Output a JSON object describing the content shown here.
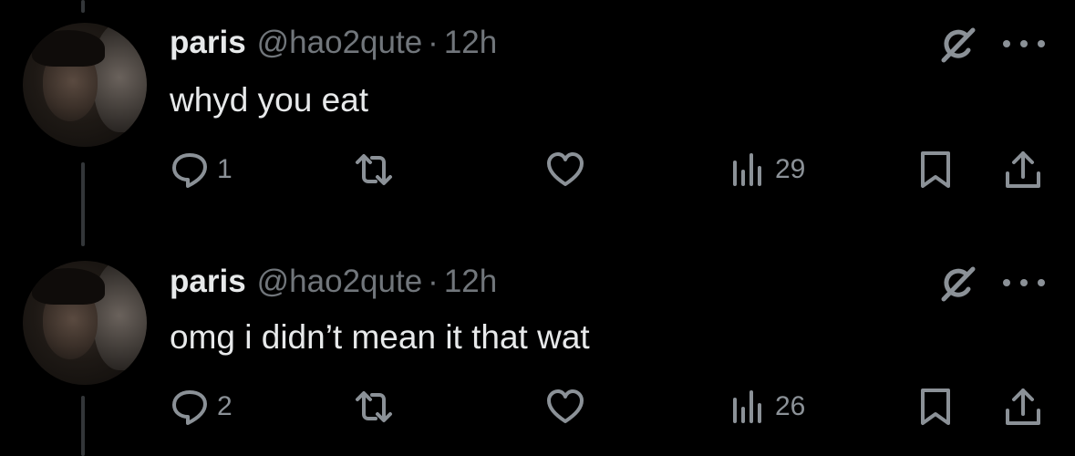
{
  "tweets": [
    {
      "display_name": "paris",
      "handle": "@hao2qute",
      "separator": "·",
      "time": "12h",
      "text": "whyd you eat",
      "replies": "1",
      "reposts": "",
      "likes": "",
      "views": "29"
    },
    {
      "display_name": "paris",
      "handle": "@hao2qute",
      "separator": "·",
      "time": "12h",
      "text": "omg i didn’t mean it that wat",
      "replies": "2",
      "reposts": "",
      "likes": "",
      "views": "26"
    }
  ],
  "icons": {
    "reply": "reply-icon",
    "repost": "repost-icon",
    "like": "like-icon",
    "views": "views-icon",
    "bookmark": "bookmark-icon",
    "share": "share-icon",
    "grok": "grok-icon",
    "more": "more-icon"
  },
  "colors": {
    "background": "#000000",
    "primary_text": "#e7e9ea",
    "secondary_text": "#71767b",
    "icon": "#8b9197",
    "thread_line": "#333639"
  }
}
